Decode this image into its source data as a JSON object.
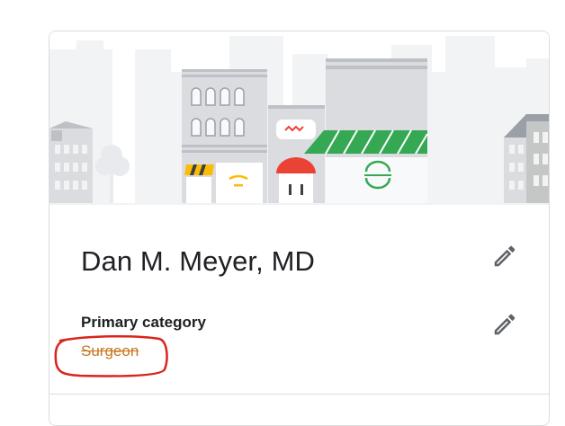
{
  "business": {
    "name": "Dan M. Meyer, MD",
    "category_label": "Primary category",
    "category_value": "Surgeon"
  },
  "icons": {
    "edit_name": "edit-pencil-icon",
    "edit_category": "edit-pencil-icon"
  },
  "colors": {
    "annotation": "#d9251c",
    "category_value": "#c5761f",
    "awning_green": "#34a853",
    "awning_red": "#ea4335",
    "awning_yellow": "#fbbc04"
  }
}
